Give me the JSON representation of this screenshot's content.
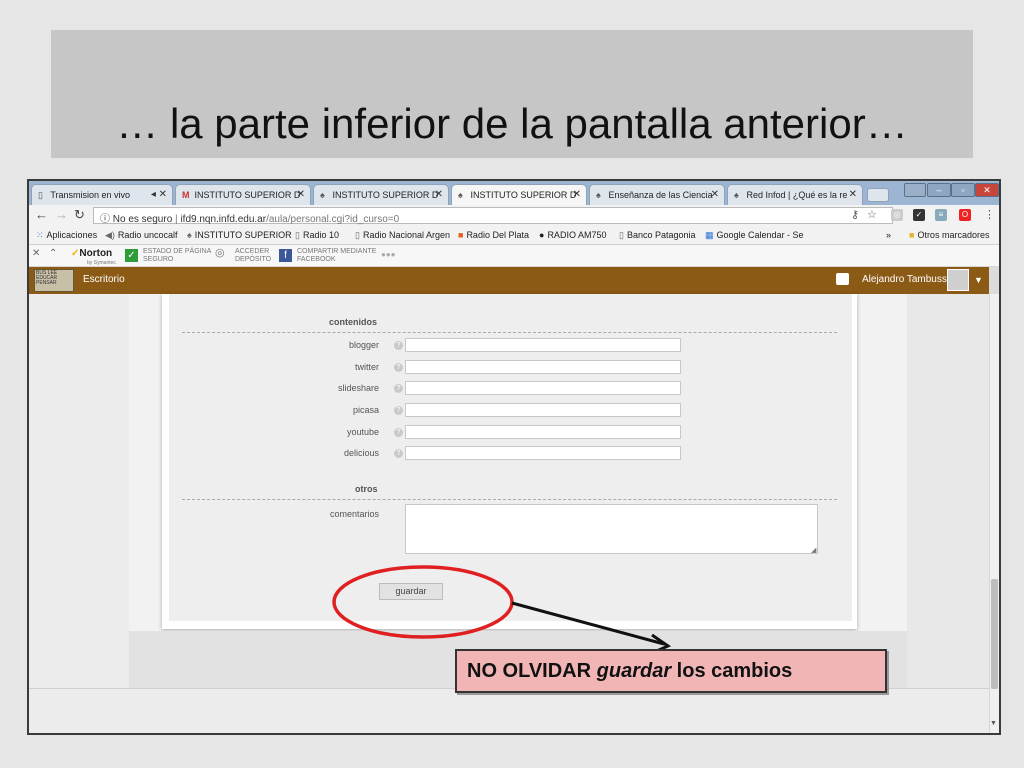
{
  "slide": {
    "title": "… la parte inferior de la pantalla anterior…"
  },
  "browser": {
    "tabs": [
      {
        "label": "Transmision en vivo"
      },
      {
        "label": "INSTITUTO SUPERIOR D"
      },
      {
        "label": "INSTITUTO SUPERIOR D"
      },
      {
        "label": "INSTITUTO SUPERIOR D"
      },
      {
        "label": "Enseñanza de las Ciencia"
      },
      {
        "label": "Red Infod | ¿Qué es la re"
      }
    ],
    "security_label": "No es seguro",
    "url_host": "ifd9.nqn.infd.edu.ar",
    "url_path": "/aula/personal.cgi?id_curso=0",
    "bookmarks": [
      {
        "label": "Aplicaciones"
      },
      {
        "label": "Radio uncocalf"
      },
      {
        "label": "INSTITUTO SUPERIOR"
      },
      {
        "label": "Radio 10"
      },
      {
        "label": "Radio Nacional Argen"
      },
      {
        "label": "Radio Del Plata"
      },
      {
        "label": "RADIO AM750"
      },
      {
        "label": "Banco Patagonia"
      },
      {
        "label": "Google Calendar - Se"
      }
    ],
    "bookmarks_overflow": "»",
    "other_bookmarks": "Otros marcadores"
  },
  "norton": {
    "logo": "Norton",
    "logo_sub": "by Symantec",
    "page_state_line1": "ESTADO DE PÁGINA",
    "page_state_line2": "SEGURO",
    "vault_line1": "ACCEDER",
    "vault_line2": "DEPÓSITO",
    "share_line1": "COMPARTIR MEDIANTE",
    "share_line2": "FACEBOOK",
    "more": "●●●"
  },
  "site": {
    "nav_label": "Escritorio",
    "user_name": "Alejandro Tambussi",
    "logo_text": "BUS LEE EDUCAR PENSAR"
  },
  "form": {
    "section_contenidos": "contenidos",
    "fields": [
      {
        "label": "blogger",
        "value": ""
      },
      {
        "label": "twitter",
        "value": ""
      },
      {
        "label": "slideshare",
        "value": ""
      },
      {
        "label": "picasa",
        "value": ""
      },
      {
        "label": "youtube",
        "value": ""
      },
      {
        "label": "delicious",
        "value": ""
      }
    ],
    "section_otros": "otros",
    "comments_label": "comentarios",
    "comments_value": "",
    "save_button": "guardar"
  },
  "annotation": {
    "note_prefix": "NO OLVIDAR ",
    "note_emphasis": "guardar",
    "note_suffix": " los cambios"
  },
  "colors": {
    "site_header": "#8b5a14",
    "annotation_ring": "#e02020",
    "annotation_note_bg": "#f2b5b5",
    "close_button": "#c8453b"
  }
}
